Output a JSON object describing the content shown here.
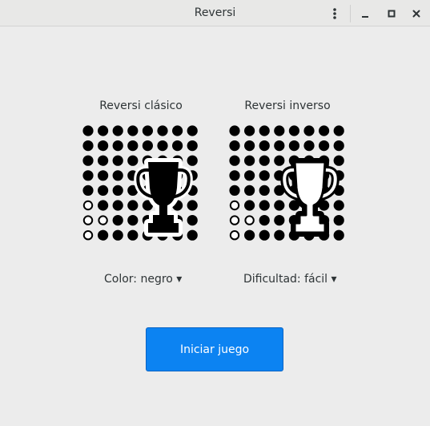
{
  "window": {
    "title": "Reversi"
  },
  "modes": {
    "classic_label": "Reversi clásico",
    "reverse_label": "Reversi inverso"
  },
  "options": {
    "color": "Color: negro ▾",
    "difficulty": "Dificultad: fácil ▾"
  },
  "start_button_label": "Iniciar juego",
  "icons": {
    "menu": "vertical-dots-icon",
    "minimize": "minimize-icon",
    "maximize": "maximize-icon",
    "close": "close-icon"
  },
  "colors": {
    "accent": "#0c83f2",
    "piece_black": "#000000",
    "piece_white": "#ffffff",
    "background": "#ececec"
  }
}
